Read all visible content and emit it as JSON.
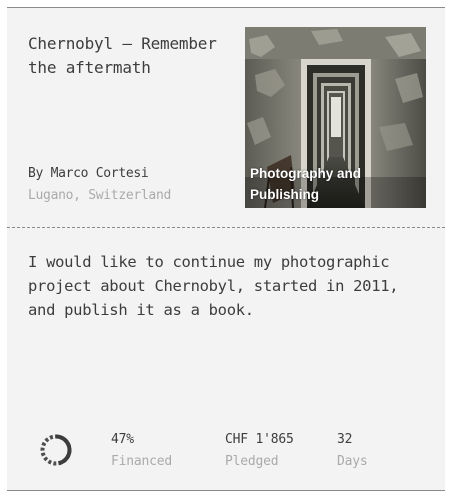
{
  "project": {
    "title": "Chernobyl – Remember the aftermath",
    "author": "By Marco Cortesi",
    "location": "Lugano, Switzerland",
    "category": "Photography and Publishing",
    "image_subject": "abandoned-corridor-photo",
    "description": "I would like to continue my photographic project about Chernobyl, started in 2011, and publish it as a book."
  },
  "funding": {
    "progress_fraction": 0.47,
    "progress_icon": "funding-progress-ring-icon",
    "financed_value": "47%",
    "financed_label": "Financed",
    "pledged_value": "CHF 1'865",
    "pledged_label": "Pledged",
    "days_value": "32",
    "days_label": "Days"
  },
  "colors": {
    "text": "#3d3d3d",
    "muted": "#aaaaaa",
    "card_background": "#f3f3f3",
    "ring": "#3d3d3d"
  }
}
